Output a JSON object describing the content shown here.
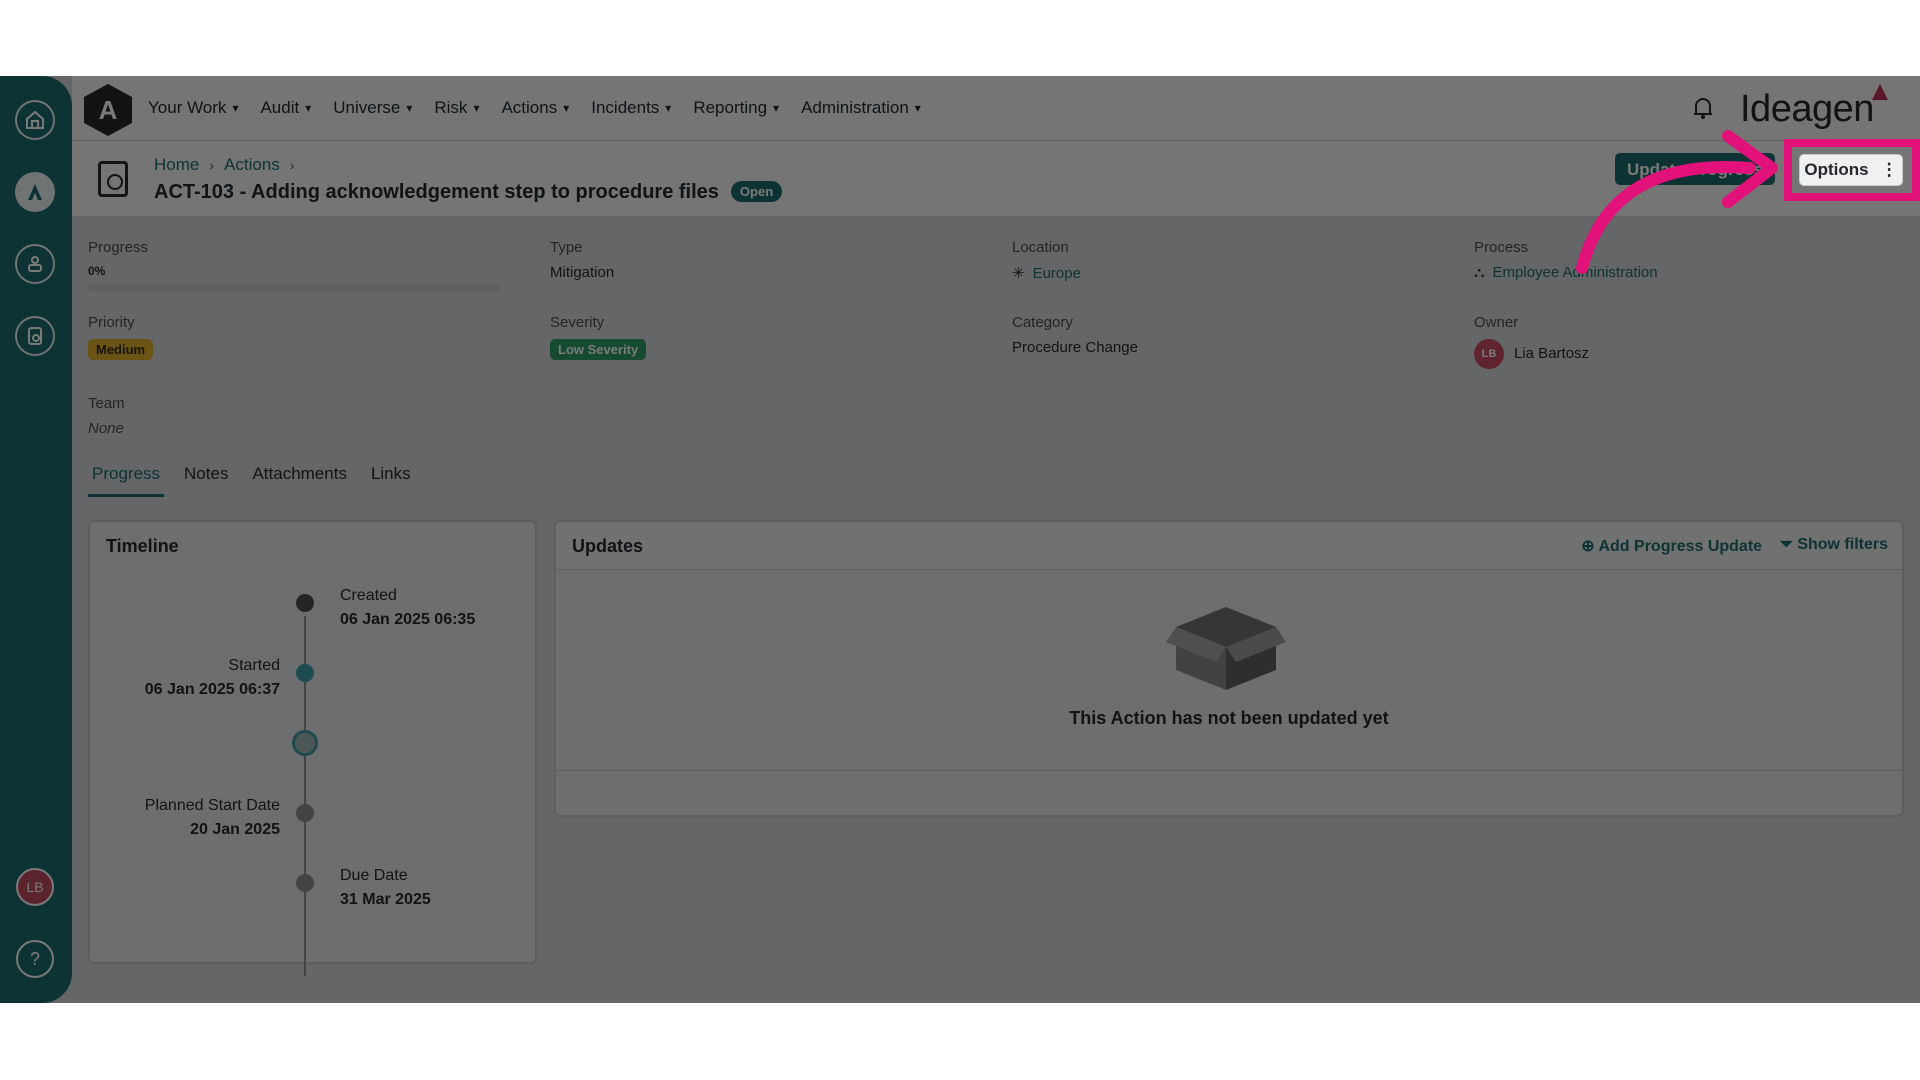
{
  "nav": {
    "items": [
      "Your Work",
      "Audit",
      "Universe",
      "Risk",
      "Actions",
      "Incidents",
      "Reporting",
      "Administration"
    ],
    "brand": "Ideagen"
  },
  "rail": {
    "avatar_initials": "LB",
    "help": "?"
  },
  "breadcrumb": {
    "home": "Home",
    "actions": "Actions"
  },
  "header": {
    "title": "ACT-103 - Adding acknowledgement step to procedure files",
    "status": "Open",
    "update_button": "Update Progress",
    "options_button": "Options"
  },
  "fields": {
    "progress": {
      "label": "Progress",
      "value": "0%",
      "fraction": 0
    },
    "type": {
      "label": "Type",
      "value": "Mitigation"
    },
    "location": {
      "label": "Location",
      "value": "Europe"
    },
    "process": {
      "label": "Process",
      "value": "Employee Administration"
    },
    "priority": {
      "label": "Priority",
      "value": "Medium"
    },
    "severity": {
      "label": "Severity",
      "value": "Low Severity"
    },
    "category": {
      "label": "Category",
      "value": "Procedure Change"
    },
    "owner": {
      "label": "Owner",
      "value": "Lia Bartosz",
      "initials": "LB"
    },
    "team": {
      "label": "Team",
      "value": "None"
    }
  },
  "tabs": [
    "Progress",
    "Notes",
    "Attachments",
    "Links"
  ],
  "timeline": {
    "title": "Timeline",
    "created": {
      "label": "Created",
      "date": "06 Jan 2025 06:35"
    },
    "started": {
      "label": "Started",
      "date": "06 Jan 2025 06:37"
    },
    "planned": {
      "label": "Planned Start Date",
      "date": "20 Jan 2025"
    },
    "due": {
      "label": "Due Date",
      "date": "31 Mar 2025"
    }
  },
  "updates": {
    "title": "Updates",
    "add": "Add Progress Update",
    "filters": "Show filters",
    "empty": "This Action has not been updated yet"
  },
  "colors": {
    "accent": "#1f6b70",
    "highlight": "#e3127a",
    "medium": "#e0b12c",
    "low": "#2f9e63"
  }
}
